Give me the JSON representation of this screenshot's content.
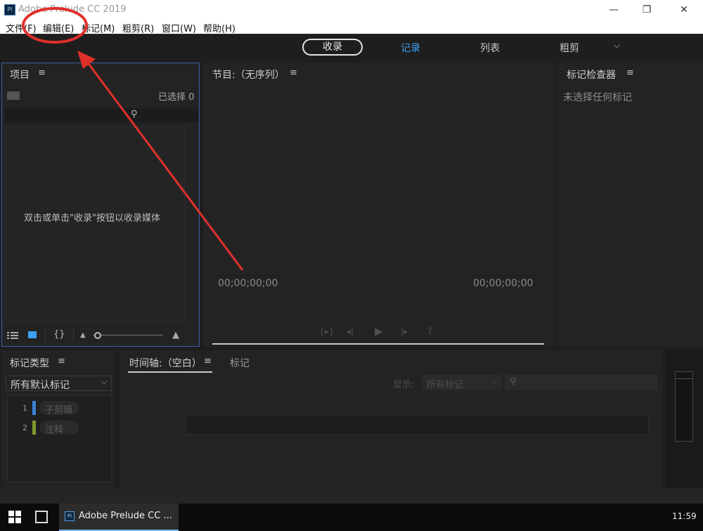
{
  "window": {
    "title": "Adobe Prelude CC 2019",
    "app_icon_text": "Pl",
    "controls": {
      "minimize": "—",
      "maximize": "❐",
      "close": "✕"
    }
  },
  "menu": [
    "文件(F)",
    "编辑(E)",
    "标记(M)",
    "粗剪(R)",
    "窗口(W)",
    "帮助(H)"
  ],
  "workspaces": {
    "ingest": "收录",
    "log": "记录",
    "list": "列表",
    "rough_cut": "粗剪",
    "more_icon": "chevron-down-icon"
  },
  "project": {
    "title": "项目",
    "selected_text": "已选择 0",
    "empty_message": "双击或单击\"收录\"按钮以收录媒体"
  },
  "program": {
    "title": "节目:（无序列）",
    "timecode_left": "00;00;00;00",
    "timecode_right": "00;00;00;00"
  },
  "inspector": {
    "title": "标记检查器",
    "message": "未选择任何标记"
  },
  "marker_types": {
    "title": "标记类型",
    "dropdown_value": "所有默认标记",
    "items": [
      {
        "num": "1",
        "label": "子剪辑",
        "color": "#3c7fd6"
      },
      {
        "num": "2",
        "label": "注释",
        "color": "#7f9a2c"
      }
    ]
  },
  "timeline": {
    "title": "时间轴:（空白）",
    "markers_tab": "标记",
    "show_label": "显示:",
    "show_value": "所有标记"
  },
  "taskbar": {
    "app_label": "Adobe Prelude CC ...",
    "clock": "11:59"
  },
  "annotation_color": "#e0302a"
}
